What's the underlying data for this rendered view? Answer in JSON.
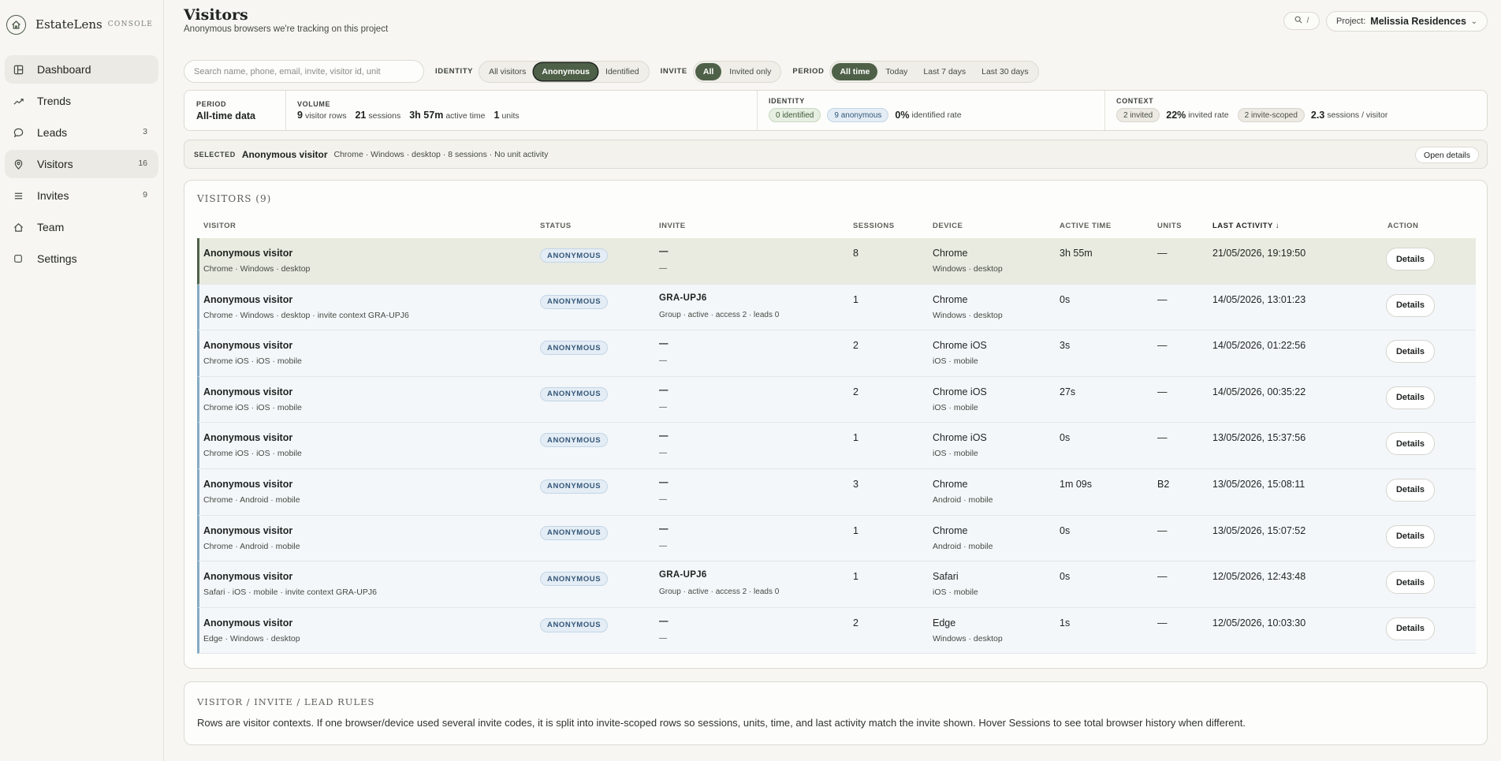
{
  "brand": {
    "name": "EstateLens",
    "sub": "CONSOLE"
  },
  "sidebar": {
    "items": [
      {
        "label": "Dashboard",
        "icon": "dashboard-icon",
        "badge": ""
      },
      {
        "label": "Trends",
        "icon": "trend-line-icon",
        "badge": ""
      },
      {
        "label": "Leads",
        "icon": "chat-bubble-icon",
        "badge": "3"
      },
      {
        "label": "Visitors",
        "icon": "location-pin-icon",
        "badge": "16"
      },
      {
        "label": "Invites",
        "icon": "list-icon",
        "badge": "9"
      },
      {
        "label": "Team",
        "icon": "home-icon",
        "badge": ""
      },
      {
        "label": "Settings",
        "icon": "square-icon",
        "badge": ""
      }
    ]
  },
  "header": {
    "title": "Visitors",
    "subtitle": "Anonymous browsers we're tracking on this project",
    "search_shortcut": "/",
    "project_label": "Project:",
    "project_name": "Melissia Residences"
  },
  "filters": {
    "search_placeholder": "Search name, phone, email, invite, visitor id, unit",
    "identity_label": "IDENTITY",
    "identity_options": [
      "All visitors",
      "Anonymous",
      "Identified"
    ],
    "invite_label": "INVITE",
    "invite_options": [
      "All",
      "Invited only"
    ],
    "period_label": "PERIOD",
    "period_options": [
      "All time",
      "Today",
      "Last 7 days",
      "Last 30 days"
    ]
  },
  "summary": {
    "period_label": "PERIOD",
    "period_value": "All-time data",
    "volume_label": "VOLUME",
    "volume": [
      {
        "num": "9",
        "unit": "visitor rows"
      },
      {
        "num": "21",
        "unit": "sessions"
      },
      {
        "num": "3h 57m",
        "unit": "active time"
      },
      {
        "num": "1",
        "unit": "units"
      }
    ],
    "identity_label": "IDENTITY",
    "identified_pill": "0 identified",
    "anonymous_pill": "9 anonymous",
    "identified_rate_num": "0%",
    "identified_rate_unit": "identified rate",
    "context_label": "CONTEXT",
    "invited_pill": "2 invited",
    "invited_rate_num": "22%",
    "invited_rate_unit": "invited rate",
    "invite_scoped_pill": "2 invite-scoped",
    "spv_num": "2.3",
    "spv_unit": "sessions / visitor"
  },
  "selected": {
    "label": "SELECTED",
    "name": "Anonymous visitor",
    "meta": "Chrome · Windows · desktop · 8 sessions · No unit activity",
    "open_button": "Open details"
  },
  "table": {
    "title": "VISITORS (9)",
    "columns": [
      "VISITOR",
      "STATUS",
      "INVITE",
      "SESSIONS",
      "DEVICE",
      "ACTIVE TIME",
      "UNITS",
      "LAST ACTIVITY ↓",
      "ACTION"
    ],
    "rows": [
      {
        "name": "Anonymous visitor",
        "meta": "Chrome · Windows · desktop",
        "status": "ANONYMOUS",
        "invite": "—",
        "invite_sub": "—",
        "sessions": "8",
        "device": "Chrome",
        "device_sub": "Windows · desktop",
        "active_time": "3h 55m",
        "units": "—",
        "last_activity": "21/05/2026, 19:19:50",
        "action": "Details"
      },
      {
        "name": "Anonymous visitor",
        "meta": "Chrome · Windows · desktop · invite context GRA-UPJ6",
        "status": "ANONYMOUS",
        "invite": "GRA-UPJ6",
        "invite_sub": "Group · active · access 2 · leads 0",
        "sessions": "1",
        "device": "Chrome",
        "device_sub": "Windows · desktop",
        "active_time": "0s",
        "units": "—",
        "last_activity": "14/05/2026, 13:01:23",
        "action": "Details"
      },
      {
        "name": "Anonymous visitor",
        "meta": "Chrome iOS · iOS · mobile",
        "status": "ANONYMOUS",
        "invite": "—",
        "invite_sub": "—",
        "sessions": "2",
        "device": "Chrome iOS",
        "device_sub": "iOS · mobile",
        "active_time": "3s",
        "units": "—",
        "last_activity": "14/05/2026, 01:22:56",
        "action": "Details"
      },
      {
        "name": "Anonymous visitor",
        "meta": "Chrome iOS · iOS · mobile",
        "status": "ANONYMOUS",
        "invite": "—",
        "invite_sub": "—",
        "sessions": "2",
        "device": "Chrome iOS",
        "device_sub": "iOS · mobile",
        "active_time": "27s",
        "units": "—",
        "last_activity": "14/05/2026, 00:35:22",
        "action": "Details"
      },
      {
        "name": "Anonymous visitor",
        "meta": "Chrome iOS · iOS · mobile",
        "status": "ANONYMOUS",
        "invite": "—",
        "invite_sub": "—",
        "sessions": "1",
        "device": "Chrome iOS",
        "device_sub": "iOS · mobile",
        "active_time": "0s",
        "units": "—",
        "last_activity": "13/05/2026, 15:37:56",
        "action": "Details"
      },
      {
        "name": "Anonymous visitor",
        "meta": "Chrome · Android · mobile",
        "status": "ANONYMOUS",
        "invite": "—",
        "invite_sub": "—",
        "sessions": "3",
        "device": "Chrome",
        "device_sub": "Android · mobile",
        "active_time": "1m 09s",
        "units": "B2",
        "last_activity": "13/05/2026, 15:08:11",
        "action": "Details"
      },
      {
        "name": "Anonymous visitor",
        "meta": "Chrome · Android · mobile",
        "status": "ANONYMOUS",
        "invite": "—",
        "invite_sub": "—",
        "sessions": "1",
        "device": "Chrome",
        "device_sub": "Android · mobile",
        "active_time": "0s",
        "units": "—",
        "last_activity": "13/05/2026, 15:07:52",
        "action": "Details"
      },
      {
        "name": "Anonymous visitor",
        "meta": "Safari · iOS · mobile · invite context GRA-UPJ6",
        "status": "ANONYMOUS",
        "invite": "GRA-UPJ6",
        "invite_sub": "Group · active · access 2 · leads 0",
        "sessions": "1",
        "device": "Safari",
        "device_sub": "iOS · mobile",
        "active_time": "0s",
        "units": "—",
        "last_activity": "12/05/2026, 12:43:48",
        "action": "Details"
      },
      {
        "name": "Anonymous visitor",
        "meta": "Edge · Windows · desktop",
        "status": "ANONYMOUS",
        "invite": "—",
        "invite_sub": "—",
        "sessions": "2",
        "device": "Edge",
        "device_sub": "Windows · desktop",
        "active_time": "1s",
        "units": "—",
        "last_activity": "12/05/2026, 10:03:30",
        "action": "Details"
      }
    ]
  },
  "rules": {
    "title": "VISITOR / INVITE / LEAD RULES",
    "text": "Rows are visitor contexts. If one browser/device used several invite codes, it is split into invite-scoped rows so sessions, units, time, and last activity match the invite shown. Hover Sessions to see total browser history when different."
  },
  "colors": {
    "accent": "#4e6148",
    "row_bg": "#f3f7fa",
    "row_border": "#87abc3",
    "selected_row_bg": "#e9ebe1",
    "badge_blue": "#34577a"
  }
}
